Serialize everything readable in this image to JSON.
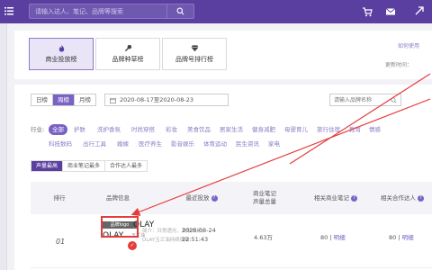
{
  "header": {
    "search_placeholder": "请输入达人、笔记、品牌等搜索",
    "icons": [
      "menu-icon",
      "search-icon",
      "cart-icon",
      "mail-icon",
      "arrow-icon"
    ]
  },
  "main_tabs": [
    {
      "label": "商业投放榜",
      "icon": "flame-icon",
      "active": true
    },
    {
      "label": "品牌种草榜",
      "icon": "microphone-icon",
      "active": false
    },
    {
      "label": "品牌号排行榜",
      "icon": "diamond-icon",
      "active": false
    }
  ],
  "help": {
    "how_to": "如何使用",
    "update_time": "更新时间："
  },
  "filters": {
    "period_options": [
      "日榜",
      "周榜",
      "月榜"
    ],
    "period_selected": "周榜",
    "date_range": "2020-08-17至2020-08-23",
    "brand_search_placeholder": "请输入品牌名称",
    "industry_label": "行业:",
    "industries_row1": [
      "全部",
      "护肤",
      "洗护香氛",
      "时尚穿搭",
      "彩妆",
      "美食饮品",
      "居家生活",
      "健身减肥",
      "母婴育儿",
      "旅行住宿",
      "教育",
      "情感"
    ],
    "industries_row2": [
      "科技数码",
      "出行工具",
      "婚嫁",
      "医疗养生",
      "影音娱乐",
      "体育运动",
      "民生资讯",
      "家电"
    ],
    "selected_industry": "全部"
  },
  "rank_tabs": {
    "items": [
      "声量最高",
      "商业笔记最多",
      "合作达人最多"
    ],
    "selected": "声量最高"
  },
  "table": {
    "headers": {
      "rank": "排行",
      "brand": "品牌信息",
      "recent": "最近投放",
      "notes_line1": "商业笔记",
      "notes_line2": "声量总量",
      "biz_notes": "相关商业笔记",
      "biz_creators": "相关合作达人"
    },
    "rows": [
      {
        "rank": "01",
        "logo_label": "品牌logo",
        "brand_name": "OLAY",
        "brand_sub": "玉兰油",
        "desc_line1": "简介：日常透光、美肤焕颜，",
        "desc_line2": "OLAY玉兰油持续焕新",
        "recent_date": "2020-08-24",
        "recent_time": "22:51:43",
        "volume": "4.63万",
        "biz_notes": "80",
        "biz_notes_link": "明细",
        "biz_creators": "80",
        "biz_creators_link": "明细"
      }
    ]
  },
  "colors": {
    "topbar": "#5b3fa0",
    "accent": "#7a62c4",
    "annotation": "#e53b3b"
  }
}
